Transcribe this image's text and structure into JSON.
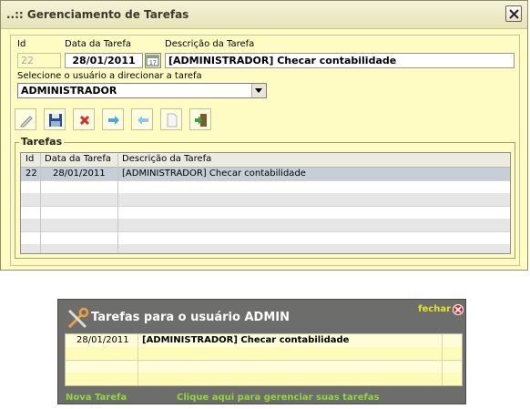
{
  "window": {
    "title": "..:: Gerenciamento de Tarefas"
  },
  "form": {
    "id_label": "Id",
    "id_value": "22",
    "date_label": "Data da Tarefa",
    "date_value": "28/01/2011",
    "desc_label": "Descrição da Tarefa",
    "desc_value": "[ADMINISTRADOR] Checar contabilidade",
    "user_label": "Selecione o usuário a direcionar a tarefa",
    "user_value": "ADMINISTRADOR"
  },
  "toolbar": {
    "buttons": [
      "edit-icon",
      "save-icon",
      "delete-icon",
      "next-icon",
      "previous-icon",
      "new-document-icon",
      "exit-icon"
    ]
  },
  "tarefas": {
    "legend": "Tarefas",
    "columns": [
      "Id",
      "Data da Tarefa",
      "Descrição da Tarefa"
    ],
    "rows": [
      {
        "id": "22",
        "date": "28/01/2011",
        "desc": "[ADMINISTRADOR] Checar contabilidade"
      }
    ]
  },
  "panel": {
    "title": "Tarefas para o usuário ADMIN",
    "close_label": "fechar",
    "rows": [
      {
        "date": "28/01/2011",
        "desc": "[ADMINISTRADOR] Checar contabilidade"
      }
    ],
    "new_task_link": "Nova Tarefa",
    "manage_link": "Clique aqui para gerenciar suas tarefas"
  }
}
